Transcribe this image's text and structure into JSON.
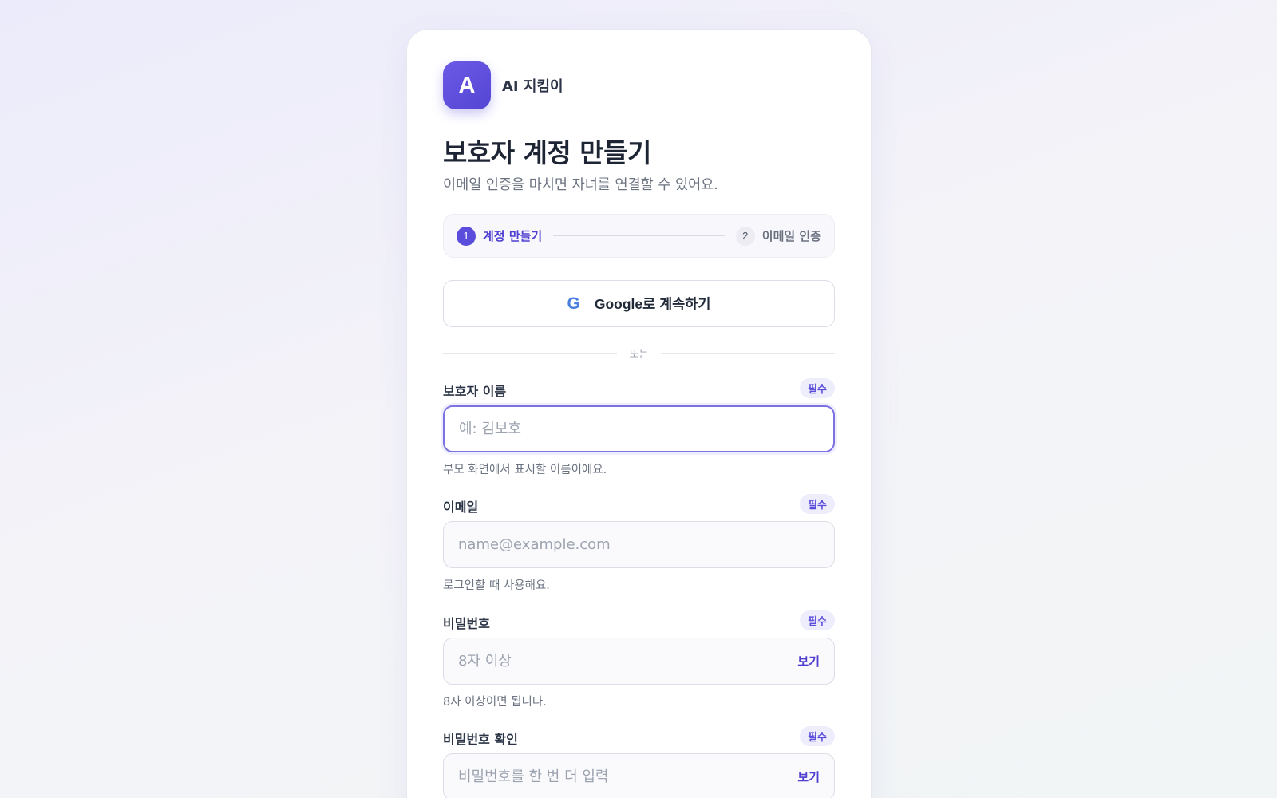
{
  "brand": {
    "logo_letter": "A",
    "name": "AI 지킴이"
  },
  "header": {
    "title": "보호자 계정 만들기",
    "subtitle": "이메일 인증을 마치면 자녀를 연결할 수 있어요."
  },
  "stepper": {
    "steps": [
      {
        "number": "1",
        "label": "계정 만들기",
        "active": true
      },
      {
        "number": "2",
        "label": "이메일 인증",
        "active": false
      }
    ]
  },
  "google_button": {
    "icon_letter": "G",
    "label": "Google로 계속하기"
  },
  "divider": {
    "text": "또는"
  },
  "form": {
    "name": {
      "label": "보호자 이름",
      "badge": "필수",
      "placeholder": "예: 김보호",
      "value": "",
      "hint": "부모 화면에서 표시할 이름이에요.",
      "focused": true
    },
    "email": {
      "label": "이메일",
      "badge": "필수",
      "placeholder": "name@example.com",
      "value": "",
      "hint": "로그인할 때 사용해요."
    },
    "password": {
      "label": "비밀번호",
      "badge": "필수",
      "placeholder": "8자 이상",
      "value": "",
      "toggle_label": "보기",
      "hint": "8자 이상이면 됩니다."
    },
    "password_confirm": {
      "label": "비밀번호 확인",
      "badge": "필수",
      "placeholder": "비밀번호를 한 번 더 입력",
      "value": "",
      "toggle_label": "보기"
    }
  },
  "colors": {
    "accent": "#5b4ddb",
    "badge_bg": "#eeedfb",
    "focus_border": "#7d72e3",
    "google_blue": "#4a7fe0"
  }
}
